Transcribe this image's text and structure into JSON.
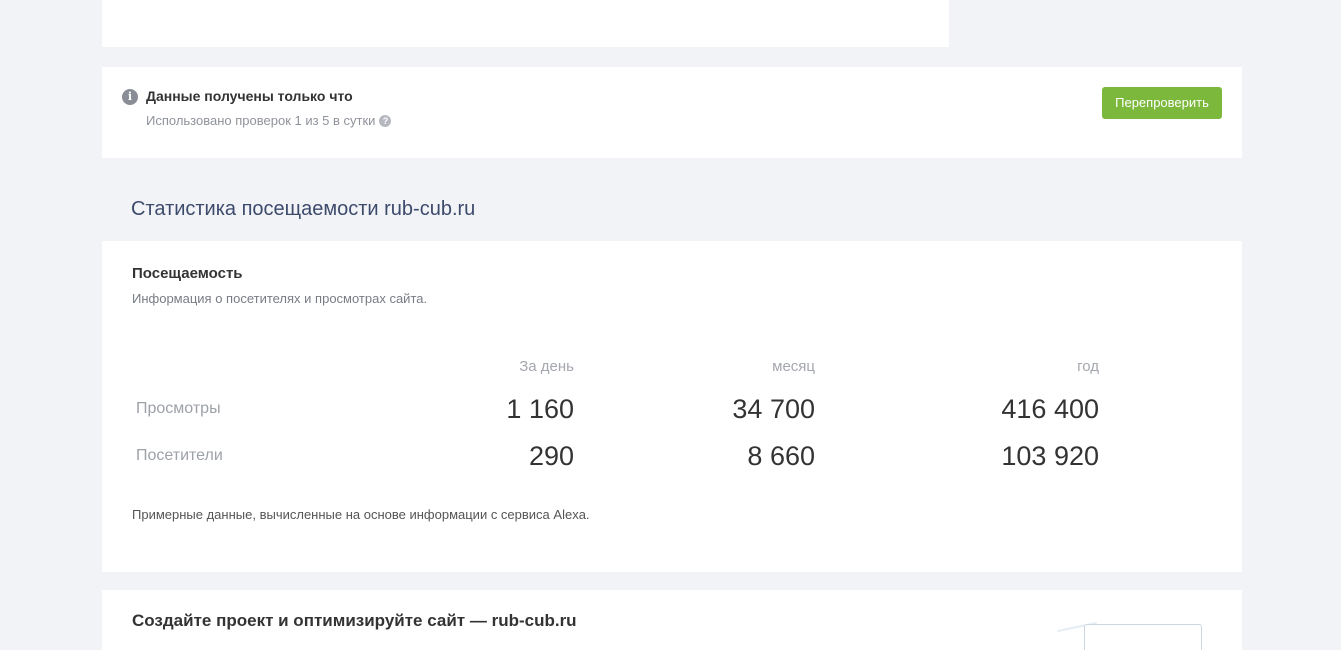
{
  "status": {
    "title": "Данные получены только что",
    "subtitle": "Использовано проверок 1 из 5 в сутки",
    "info_icon": "i",
    "help_icon": "?",
    "recheck_label": "Перепроверить"
  },
  "section": {
    "title": "Статистика посещаемости rub-cub.ru"
  },
  "traffic": {
    "title": "Посещаемость",
    "description": "Информация о посетителях и просмотрах сайта.",
    "columns": [
      "За день",
      "месяц",
      "год"
    ],
    "rows": [
      {
        "label": "Просмотры",
        "values": [
          "1 160",
          "34 700",
          "416 400"
        ]
      },
      {
        "label": "Посетители",
        "values": [
          "290",
          "8 660",
          "103 920"
        ]
      }
    ],
    "note": "Примерные данные, вычисленные на основе информации с сервиса Alexa."
  },
  "project": {
    "title": "Создайте проект и оптимизируйте сайт — rub-cub.ru"
  },
  "colors": {
    "accent_green": "#7cb83c",
    "section_title": "#3c4a6c",
    "background": "#f2f3f7"
  }
}
